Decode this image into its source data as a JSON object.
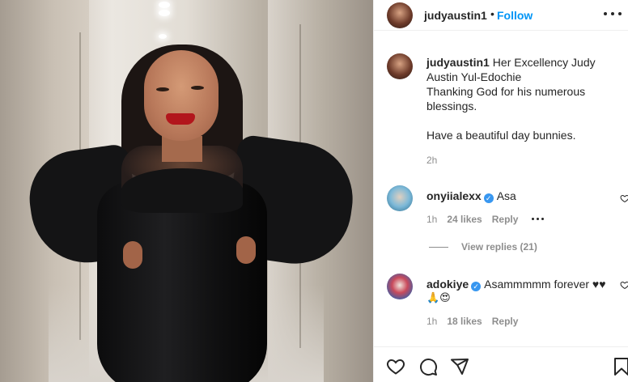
{
  "post": {
    "username": "judyaustin1",
    "follow_label": "Follow",
    "separator": "•"
  },
  "caption": {
    "username": "judyaustin1",
    "line1": "Her Excellency Judy Austin Yul-Edochie",
    "line2": "Thanking God for his numerous blessings.",
    "line3": "Have a beautiful day bunnies.",
    "time": "2h"
  },
  "comments": [
    {
      "username": "onyiialexx",
      "verified": true,
      "text": "Asa",
      "time": "1h",
      "likes": "24 likes",
      "reply_label": "Reply",
      "view_replies": "View replies (21)"
    },
    {
      "username": "adokiye",
      "verified": true,
      "text": "Asammmmm forever ♥♥",
      "text_line2": "🙏😍",
      "time": "1h",
      "likes": "18 likes",
      "reply_label": "Reply"
    }
  ],
  "icons": {
    "verified": "✓",
    "like": "heart-icon",
    "comment": "comment-icon",
    "share": "share-icon",
    "more": "more-icon"
  },
  "colors": {
    "accent": "#0095f6",
    "verified": "#3897f0",
    "muted": "#8e8e8e",
    "text": "#262626"
  }
}
